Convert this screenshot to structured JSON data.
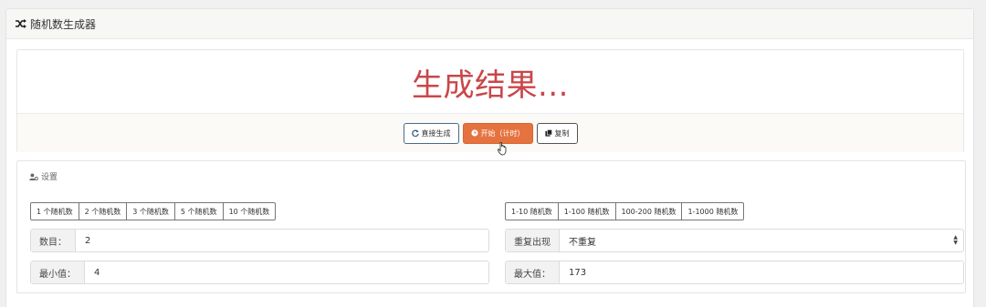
{
  "header": {
    "title": "随机数生成器",
    "icon": "shuffle-icon"
  },
  "result": {
    "text": "生成结果..."
  },
  "actions": {
    "direct_label": "直接生成",
    "start_label": "开始（计时）",
    "copy_label": "复制"
  },
  "settings": {
    "title": "设置",
    "count_presets": [
      "1 个随机数",
      "2 个随机数",
      "3 个随机数",
      "5 个随机数",
      "10 个随机数"
    ],
    "range_presets": [
      "1-10 随机数",
      "1-100 随机数",
      "100-200 随机数",
      "1-1000 随机数"
    ],
    "count": {
      "label": "数目：",
      "value": "2"
    },
    "repeat": {
      "label": "重复出现",
      "value": "不重复"
    },
    "min": {
      "label": "最小值：",
      "value": "4"
    },
    "max": {
      "label": "最大值：",
      "value": "173"
    }
  },
  "colors": {
    "accent": "#e5733f",
    "result_text": "#c9474a",
    "button_border": "#4a6c86"
  }
}
